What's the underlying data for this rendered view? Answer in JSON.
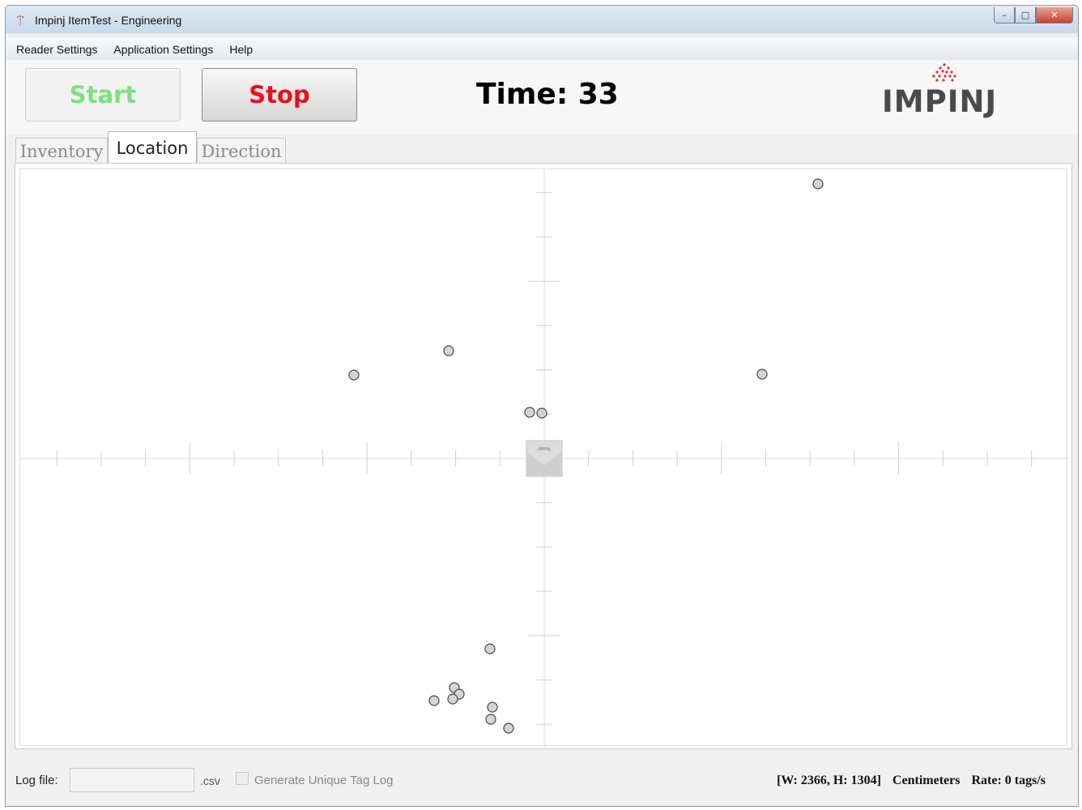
{
  "window": {
    "title": "Impinj ItemTest - Engineering"
  },
  "menu": {
    "items": [
      {
        "label": "Reader Settings"
      },
      {
        "label": "Application Settings"
      },
      {
        "label": "Help"
      }
    ]
  },
  "toolbar": {
    "start_label": "Start",
    "stop_label": "Stop",
    "time_text": "Time: 33",
    "logo_text": "IMPINJ",
    "start_color": "#7ee07e",
    "stop_color": "#e8101a"
  },
  "tabs": [
    {
      "label": "Inventory",
      "active": false
    },
    {
      "label": "Location",
      "active": true
    },
    {
      "label": "Direction",
      "active": false
    }
  ],
  "location_view": {
    "reader_label": "IMPINJ"
  },
  "status": {
    "log_label": "Log file:",
    "log_value": "",
    "csv_suffix": ".csv",
    "generate_label": "Generate Unique Tag Log",
    "generate_checked": false,
    "dimensions_text": "[W: 2366, H: 1304]",
    "units_text": "Centimeters",
    "rate_text": "Rate: 0 tags/s"
  }
}
